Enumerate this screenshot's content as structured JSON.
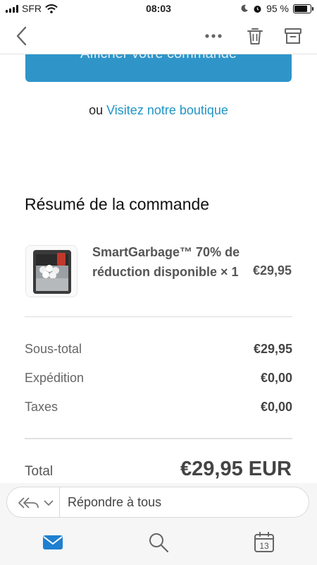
{
  "status_bar": {
    "carrier": "SFR",
    "time": "08:03",
    "battery": "95 %",
    "battery_level": 0.95
  },
  "navbar": {
    "back_icon": "chevron-left-icon",
    "more_icon": "more-dots-icon",
    "trash_icon": "trash-icon",
    "archive_icon": "archive-icon"
  },
  "email": {
    "cta_label": "Afficher votre commande",
    "or_text": "ou",
    "shop_link": "Visitez notre boutique",
    "summary_title": "Résumé de la commande",
    "item": {
      "name": "SmartGarbage™ 70% de réduction disponible × 1",
      "price": "€29,95"
    },
    "totals": {
      "subtotal_label": "Sous-total",
      "subtotal_value": "€29,95",
      "shipping_label": "Expédition",
      "shipping_value": "€0,00",
      "taxes_label": "Taxes",
      "taxes_value": "€0,00",
      "total_label": "Total",
      "total_value": "€29,95 EUR"
    }
  },
  "reply_bar": {
    "placeholder": "Répondre à tous",
    "icon": "reply-all-icon"
  },
  "tab_bar": {
    "mail_icon": "mail-icon",
    "search_icon": "search-icon",
    "calendar_icon": "calendar-icon",
    "calendar_day": "13",
    "accent_color": "#1f7fd1"
  }
}
